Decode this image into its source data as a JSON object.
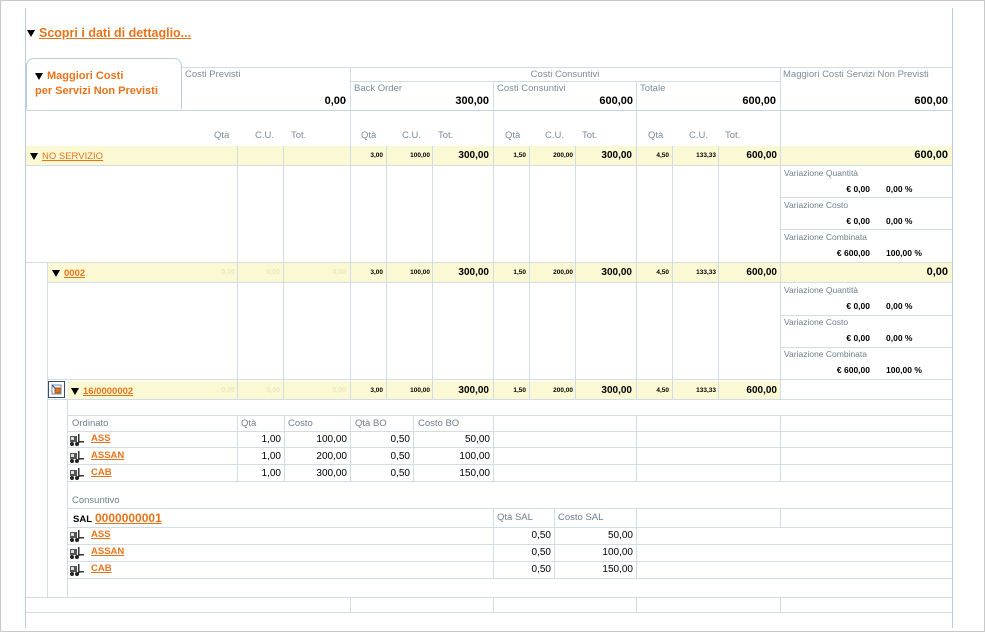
{
  "header": {
    "title": "Scopri i dati di dettaglio..."
  },
  "tab": {
    "line1": "Maggiori Costi",
    "line2": "per Servizi Non Previsti"
  },
  "sections": {
    "costi_previsti": "Costi Previsti",
    "costi_consuntivi": "Costi Consuntivi",
    "maggiori_costi": "Maggiori Costi Servizi Non Previsti"
  },
  "subsections": {
    "back_order": "Back Order",
    "costi_consuntivi": "Costi Consuntivi",
    "totale": "Totale"
  },
  "summary": {
    "costi_previsti": "0,00",
    "back_order": "300,00",
    "costi_consuntivi": "600,00",
    "totale": "600,00",
    "maggiori_costi": "600,00"
  },
  "columns": {
    "qta": "Qtà",
    "cu": "C.U.",
    "tot": "Tot."
  },
  "rows": {
    "no_servizio": {
      "label": "NO SERVIZIO",
      "bo": {
        "qta": "3,00",
        "cu": "100,00",
        "tot": "300,00"
      },
      "cc": {
        "qta": "1,50",
        "cu": "200,00",
        "tot": "300,00"
      },
      "tt": {
        "qta": "4,50",
        "cu": "133,33",
        "tot": "600,00"
      },
      "maggiori": "600,00",
      "variazioni": [
        {
          "label": "Variazione Quantità",
          "value": "€ 0,00",
          "pct": "0,00 %"
        },
        {
          "label": "Variazione Costo",
          "value": "€ 0,00",
          "pct": "0,00 %"
        },
        {
          "label": "Variazione Combinata",
          "value": "€ 600,00",
          "pct": "100,00 %"
        }
      ]
    },
    "r0002": {
      "label": "0002",
      "prev": {
        "qta": "0,00",
        "cu": "0,00",
        "tot": "0,00"
      },
      "bo": {
        "qta": "3,00",
        "cu": "100,00",
        "tot": "300,00"
      },
      "cc": {
        "qta": "1,50",
        "cu": "200,00",
        "tot": "300,00"
      },
      "tt": {
        "qta": "4,50",
        "cu": "133,33",
        "tot": "600,00"
      },
      "maggiori": "0,00",
      "variazioni": [
        {
          "label": "Variazione Quantità",
          "value": "€ 0,00",
          "pct": "0,00 %"
        },
        {
          "label": "Variazione Costo",
          "value": "€ 0,00",
          "pct": "0,00 %"
        },
        {
          "label": "Variazione Combinata",
          "value": "€ 600,00",
          "pct": "100,00 %"
        }
      ]
    },
    "r16": {
      "label": "16/0000002",
      "prev": {
        "qta": "0,00",
        "cu": "0,00",
        "tot": "0,00"
      },
      "bo": {
        "qta": "3,00",
        "cu": "100,00",
        "tot": "300,00"
      },
      "cc": {
        "qta": "1,50",
        "cu": "200,00",
        "tot": "300,00"
      },
      "tt": {
        "qta": "4,50",
        "cu": "133,33",
        "tot": "600,00"
      }
    }
  },
  "ordinato": {
    "title": "Ordinato",
    "headers": {
      "qta": "Qtà",
      "costo": "Costo",
      "qta_bo": "Qtà BO",
      "costo_bo": "Costo BO"
    },
    "items": [
      {
        "name": "ASS",
        "qta": "1,00",
        "costo": "100,00",
        "qta_bo": "0,50",
        "costo_bo": "50,00"
      },
      {
        "name": "ASSAN",
        "qta": "1,00",
        "costo": "200,00",
        "qta_bo": "0,50",
        "costo_bo": "100,00"
      },
      {
        "name": "CAB",
        "qta": "1,00",
        "costo": "300,00",
        "qta_bo": "0,50",
        "costo_bo": "150,00"
      }
    ]
  },
  "consuntivo": {
    "title": "Consuntivo",
    "sal_label": "SAL",
    "sal_code": "0000000001",
    "headers": {
      "qta_sal": "Qtà SAL",
      "costo_sal": "Costo SAL"
    },
    "items": [
      {
        "name": "ASS",
        "qta_sal": "0,50",
        "costo_sal": "50,00"
      },
      {
        "name": "ASSAN",
        "qta_sal": "0,50",
        "costo_sal": "100,00"
      },
      {
        "name": "CAB",
        "qta_sal": "0,50",
        "costo_sal": "150,00"
      }
    ]
  },
  "colors": {
    "accent": "#e8731a",
    "band": "#fbf9d3",
    "grid": "#d2dce6"
  },
  "icons": {
    "row": "forklift-icon",
    "expand": "expand-tree-icon"
  }
}
